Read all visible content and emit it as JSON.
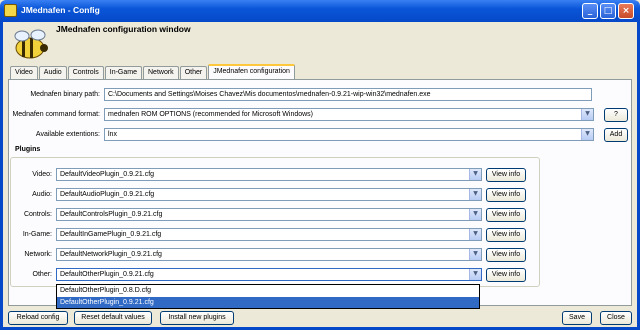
{
  "window": {
    "title": "JMednafen - Config"
  },
  "header": {
    "title": "JMednafen configuration window"
  },
  "tabs": [
    {
      "label": "Video"
    },
    {
      "label": "Audio"
    },
    {
      "label": "Controls"
    },
    {
      "label": "In-Game"
    },
    {
      "label": "Network"
    },
    {
      "label": "Other"
    },
    {
      "label": "JMednafen configuration"
    }
  ],
  "config": {
    "binary_path_label": "Mednafen binary path:",
    "binary_path_value": "C:\\Documents and Settings\\Moises Chavez\\Mis documentos\\mednafen-0.9.21-wip-win32\\mednafen.exe",
    "command_format_label": "Mednafen command format:",
    "command_format_value": "mednafen ROM OPTIONS (recommended for Microsoft Windows)",
    "help_button": "?",
    "extensions_label": "Available extentions:",
    "extensions_value": "lnx",
    "add_button": "Add"
  },
  "plugins": {
    "title": "Plugins",
    "view_info_label": "View info",
    "rows": [
      {
        "label": "Video:",
        "value": "DefaultVideoPlugin_0.9.21.cfg"
      },
      {
        "label": "Audio:",
        "value": "DefaultAudioPlugin_0.9.21.cfg"
      },
      {
        "label": "Controls:",
        "value": "DefaultControlsPlugin_0.9.21.cfg"
      },
      {
        "label": "In-Game:",
        "value": "DefaultInGamePlugin_0.9.21.cfg"
      },
      {
        "label": "Network:",
        "value": "DefaultNetworkPlugin_0.9.21.cfg"
      },
      {
        "label": "Other:",
        "value": "DefaultOtherPlugin_0.9.21.cfg"
      }
    ],
    "other_dropdown_options": [
      "DefaultOtherPlugin_0.8.D.cfg",
      "DefaultOtherPlugin_0.9.21.cfg"
    ]
  },
  "footer": {
    "reload": "Reload config",
    "reset": "Reset default values",
    "install": "Install new plugins",
    "save": "Save",
    "close": "Close"
  }
}
